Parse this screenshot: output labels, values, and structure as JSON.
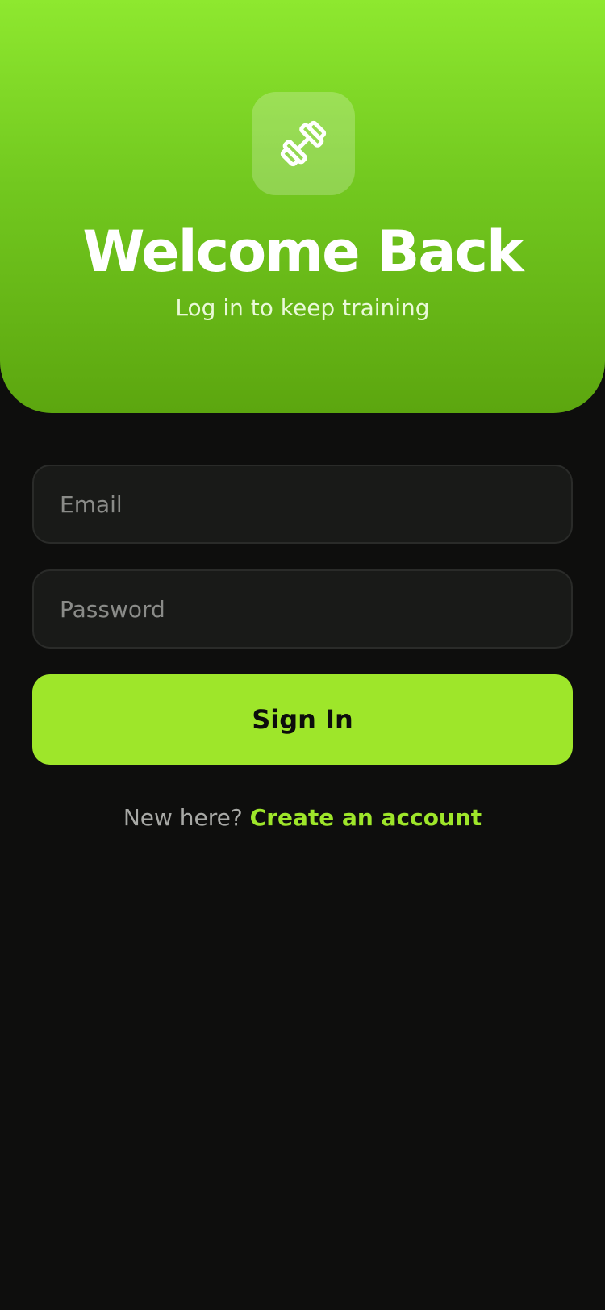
{
  "header": {
    "logo_icon": "dumbbell-icon",
    "title": "Welcome Back",
    "subtitle": "Log in to keep training"
  },
  "form": {
    "email_placeholder": "Email",
    "email_value": "",
    "password_placeholder": "Password",
    "password_value": "",
    "submit_label": "Sign In"
  },
  "footer": {
    "prompt": "New here?",
    "link_label": "Create an account"
  },
  "colors": {
    "accent": "#9ee62a",
    "background": "#0e0e0d",
    "field_background": "#191a18",
    "hero_top": "#8ee82f",
    "hero_bottom": "#5ca60f"
  }
}
